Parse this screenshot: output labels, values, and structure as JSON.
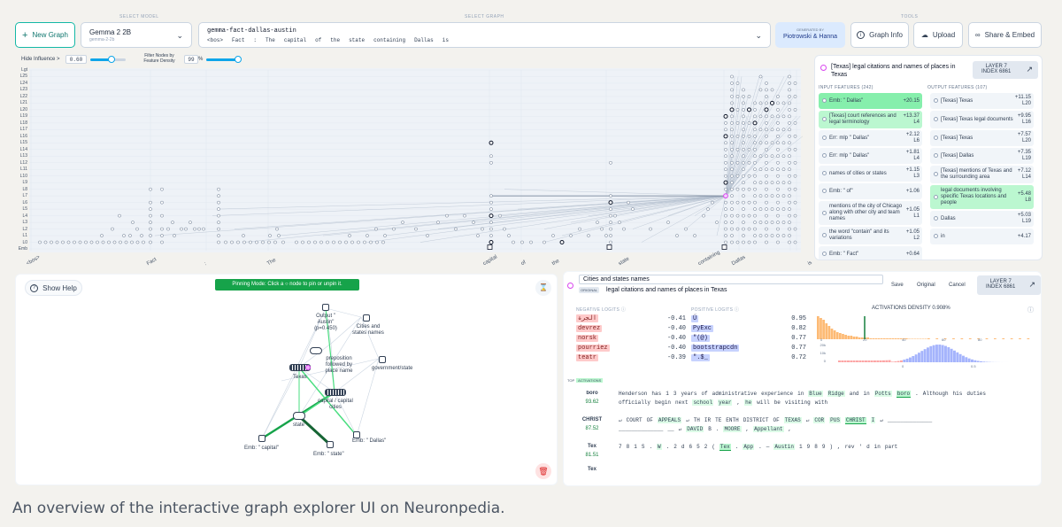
{
  "header": {
    "select_model_label": "SELECT MODEL",
    "select_graph_label": "SELECT GRAPH",
    "tools_label": "TOOLS",
    "new_graph": "New Graph",
    "model_name": "Gemma 2 2B",
    "model_id": "gemma-2-2b",
    "graph_id": "gemma-fact-dallas-austin",
    "prompt_tokens": [
      "<bos>",
      "Fact",
      ":",
      "The",
      "capital",
      "of",
      "the",
      "state",
      "containing",
      "Dallas",
      "is"
    ],
    "generated_by_label": "GENERATED BY",
    "generated_by": "Piotrowski & Hanna",
    "graph_info": "Graph Info",
    "upload": "Upload",
    "share": "Share & Embed"
  },
  "controls": {
    "hide_influence_label": "Hide Influence >",
    "hide_influence_value": "0.60",
    "hide_influence_level": 0.6,
    "filter_label": "Filter Nodes by Feature Density",
    "filter_value": "99",
    "filter_unit": "%",
    "filter_level": 0.99
  },
  "graph": {
    "layers": [
      "Lgt",
      "L25",
      "L24",
      "L23",
      "L22",
      "L21",
      "L20",
      "L19",
      "L18",
      "L17",
      "L16",
      "L15",
      "L14",
      "L13",
      "L12",
      "L11",
      "L10",
      "L9",
      "L8",
      "L7",
      "L6",
      "L5",
      "L4",
      "L3",
      "L2",
      "L1",
      "L0",
      "Emb"
    ],
    "token_labels": [
      "<bos>",
      "Fact",
      ":",
      "The",
      "capital",
      "of",
      "the",
      "state",
      "containing",
      "Dallas",
      "is"
    ]
  },
  "node_panel": {
    "title": "[Texas] legal citations and names of places in Texas",
    "layer_label": "LAYER 7",
    "index_label": "INDEX 6861",
    "input_header": "INPUT FEATURES (242)",
    "output_header": "OUTPUT FEATURES (107)",
    "inputs": [
      {
        "text": "Emb: \" Dallas\"",
        "value": "+20.15",
        "layer": "",
        "color": "#86efac"
      },
      {
        "text": "[Texas] court references and legal terminology",
        "value": "+13.37",
        "layer": "L4",
        "color": "#bbf7d0"
      },
      {
        "text": "Err: mlp \" Dallas\"",
        "value": "+2.12",
        "layer": "L6",
        "color": "#f1f5f9"
      },
      {
        "text": "Err: mlp \" Dallas\"",
        "value": "+1.81",
        "layer": "L4",
        "color": "#f1f5f9"
      },
      {
        "text": "names of cities or states",
        "value": "+1.15",
        "layer": "L3",
        "color": "#f1f5f9"
      },
      {
        "text": "Emb: \" of\"",
        "value": "+1.06",
        "layer": "",
        "color": "#f1f5f9"
      },
      {
        "text": "mentions of the city of Chicago along with other city and team names",
        "value": "+1.05",
        "layer": "L1",
        "color": "#f1f5f9"
      },
      {
        "text": "the word \"contain\" and its variations",
        "value": "+1.05",
        "layer": "L2",
        "color": "#f1f5f9"
      },
      {
        "text": "Emb: \" Fact\"",
        "value": "+0.64",
        "layer": "",
        "color": "#f1f5f9"
      }
    ],
    "outputs": [
      {
        "text": "[Texas] Texas",
        "value": "+11.15",
        "layer": "L20",
        "color": "#f1f5f9"
      },
      {
        "text": "[Texas] Texas legal documents",
        "value": "+9.95",
        "layer": "L16",
        "color": "#f1f5f9"
      },
      {
        "text": "[Texas] Texas",
        "value": "+7.57",
        "layer": "L20",
        "color": "#f1f5f9"
      },
      {
        "text": "[Texas] Dallas",
        "value": "+7.35",
        "layer": "L19",
        "color": "#f1f5f9"
      },
      {
        "text": "[Texas] mentions of Texas and the surrounding area",
        "value": "+7.12",
        "layer": "L14",
        "color": "#f1f5f9"
      },
      {
        "text": "legal documents involving specific Texas locations and people",
        "value": "+5.48",
        "layer": "L8",
        "color": "#bbf7d0"
      },
      {
        "text": "Dallas",
        "value": "+5.03",
        "layer": "L19",
        "color": "#f1f5f9"
      },
      {
        "text": "in",
        "value": "+4.17",
        "layer": "",
        "color": "#f1f5f9"
      }
    ]
  },
  "subgraph": {
    "show_help": "Show Help",
    "pinning_mode": "Pinning Mode: Click a ○ node to pin or unpin it.",
    "nodes": {
      "output": "Output \" Austin\" (p=0.450)",
      "cities": "Cities and states names",
      "preposition": "preposition followed by place name",
      "government": "government/state",
      "texas": "Texas",
      "capital": "capital / capital cities",
      "state": "state",
      "emb_capital": "Emb: \" capital\"",
      "emb_state": "Emb: \" state\"",
      "emb_dallas": "Emb: \" Dallas\""
    }
  },
  "feature_detail": {
    "name_value": "Cities and states names",
    "save": "Save",
    "original": "Original",
    "cancel": "Cancel",
    "original_tag": "ORIGINAL",
    "original_desc": "legal citations and names of places in Texas",
    "layer_label": "LAYER 7",
    "index_label": "INDEX 6861",
    "negative_header": "NEGATIVE LOGITS",
    "positive_header": "POSITIVE LOGITS",
    "density_header": "ACTIVATIONS DENSITY 0.908%",
    "negative_logits": [
      {
        "token": "الجرة",
        "value": "-0.41"
      },
      {
        "token": "devrez",
        "value": "-0.40"
      },
      {
        "token": "norsk",
        "value": "-0.40"
      },
      {
        "token": "pourriez",
        "value": "-0.40"
      },
      {
        "token": "teatr",
        "value": "-0.39"
      }
    ],
    "positive_logits": [
      {
        "token": "Ű",
        "value": "0.95"
      },
      {
        "token": "PyExc",
        "value": "0.82"
      },
      {
        "token": "\"(@)",
        "value": "0.77"
      },
      {
        "token": "bootstrapcdn",
        "value": "0.77"
      },
      {
        "token": "\".$_",
        "value": "0.72"
      }
    ],
    "hist_top_ticks": [
      "0",
      "20",
      "40",
      "60",
      "80"
    ],
    "hist_bottom_y": [
      "20k",
      "10k",
      "0"
    ],
    "hist_bottom_x": [
      "0",
      "0.5"
    ],
    "top_activations_label": "TOP",
    "activations_label": "ACTIVATIONS",
    "activations": [
      {
        "token": "boro",
        "score": "93.62",
        "line1": [
          "Henderson",
          "has",
          "1",
          "3",
          "years",
          "of",
          "administrative",
          "experience",
          "in",
          "Blue",
          "Ridge",
          "and",
          "in",
          "Potts",
          "boro",
          ".",
          "Although",
          "his",
          "duties"
        ],
        "line2": [
          "officially",
          "begin",
          "next",
          "school",
          "year",
          ",",
          "he",
          "will",
          "be",
          "visiting",
          "with"
        ]
      },
      {
        "token": "CHRIST",
        "score": "87.52",
        "line1": [
          "↵",
          "COURT",
          "OF",
          "APPEALS",
          "↵",
          "TH",
          "IR",
          "TE",
          "ENTH",
          "DISTRICT",
          "OF",
          "TEXAS",
          "↵",
          "COR",
          "PUS",
          "CHRIST",
          "I",
          "↵",
          "______________"
        ],
        "line2": [
          "______________",
          "__",
          "↵",
          "DAVID",
          "B",
          ".",
          "MOORE",
          ",",
          "Appellant",
          ","
        ]
      },
      {
        "token": "Tex",
        "score": "81.51",
        "line1": [
          "7",
          "8",
          "1",
          "S",
          ".",
          "W",
          ".",
          "2",
          "d",
          "6",
          "5",
          "2",
          "(",
          "Tex",
          ".",
          "App",
          ".",
          "—",
          "Austin",
          "1",
          "9",
          "8",
          "9",
          ")",
          ",",
          "rev",
          "'",
          "d",
          "in",
          "part"
        ]
      },
      {
        "token": "Tex",
        "score": ""
      }
    ]
  },
  "caption": "An overview of the interactive graph explorer UI on Neuronpedia."
}
